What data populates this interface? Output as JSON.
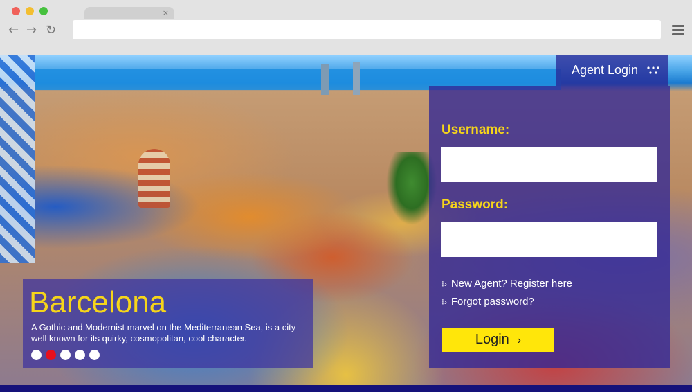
{
  "browser": {
    "tab_close": "×",
    "nav_back": "←",
    "nav_forward": "→",
    "nav_reload": "↻",
    "url": ""
  },
  "agent_tab": {
    "label": "Agent Login",
    "icon": "dots-icon"
  },
  "login": {
    "username_label": "Username:",
    "password_label": "Password:",
    "username_value": "",
    "password_value": "",
    "register_link": "New Agent? Register here",
    "forgot_link": "Forgot password?",
    "link_arrow": "⁝›",
    "button_label": "Login",
    "button_chevron": "›"
  },
  "hero": {
    "title": "Barcelona",
    "description": "A Gothic and Modernist marvel on the Mediterranean Sea, is a city well known for its quirky, cosmopolitan, cool character.",
    "carousel_count": 5,
    "carousel_active_index": 1
  },
  "colors": {
    "accent_yellow": "#f6d51a",
    "button_yellow": "#ffe60a",
    "panel_blue": "#322896",
    "active_dot": "#e8101e"
  }
}
